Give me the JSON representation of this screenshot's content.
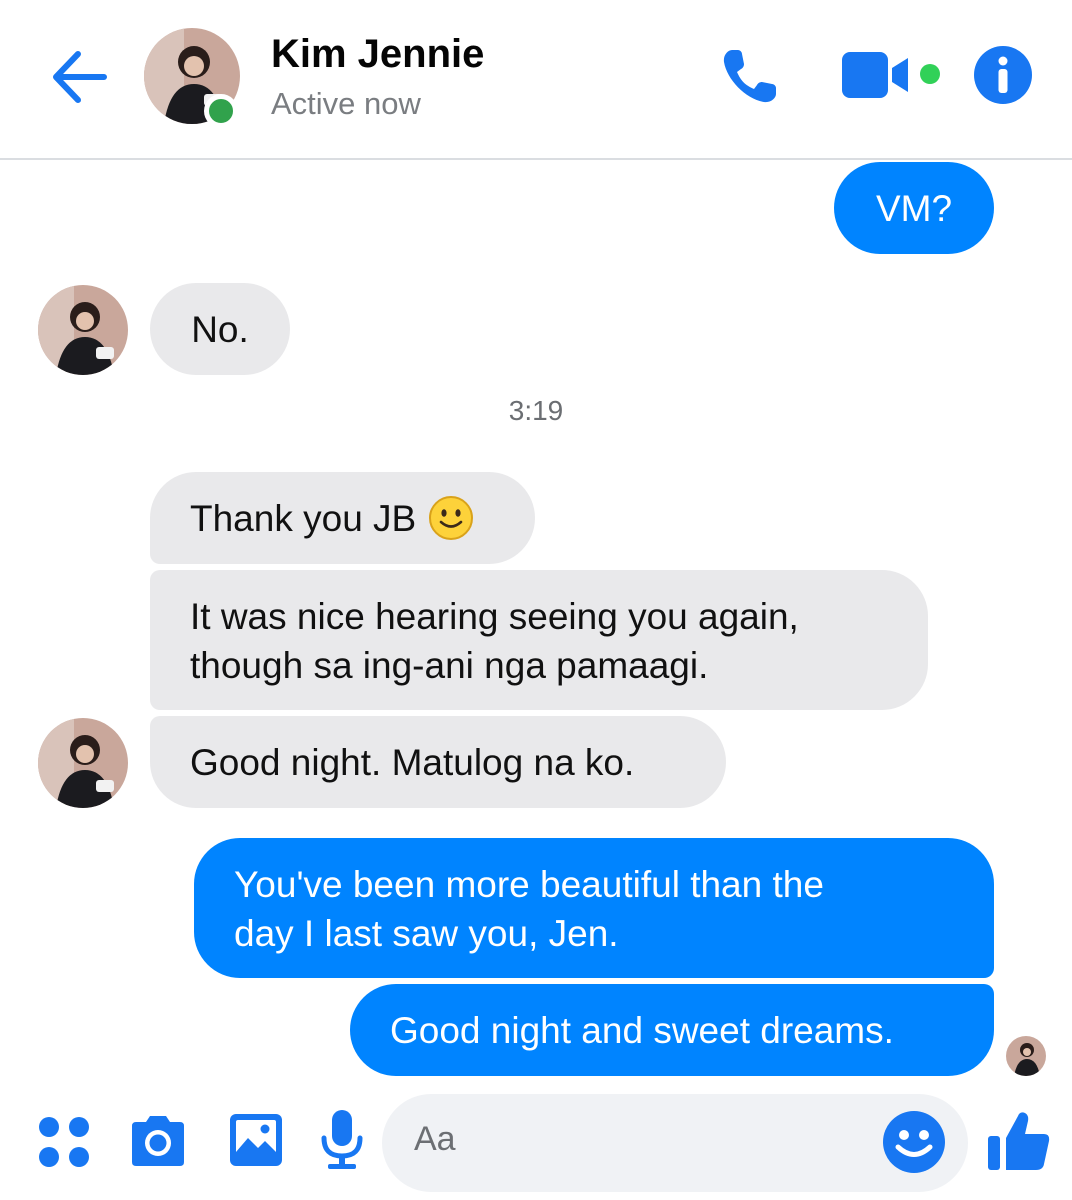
{
  "header": {
    "contact_name": "Kim Jennie",
    "status": "Active now"
  },
  "colors": {
    "messenger_blue": "#0084ff",
    "icon_blue": "#1877f2",
    "incoming_bubble": "#e9e9eb",
    "online_green": "#31a24c"
  },
  "messages": [
    {
      "from": "me",
      "text": "VM?"
    },
    {
      "from": "contact",
      "text": "No."
    },
    {
      "timestamp": "3:19"
    },
    {
      "from": "contact",
      "text": "Thank you JB",
      "emoji": "slightly-smiling-face"
    },
    {
      "from": "contact",
      "line1": "It was nice hearing seeing you again,",
      "line2": "though sa ing-ani nga pamaagi."
    },
    {
      "from": "contact",
      "text": "Good night. Matulog na ko."
    },
    {
      "from": "me",
      "line1": "You've been more beautiful than the",
      "line2": "day I last saw you, Jen."
    },
    {
      "from": "me",
      "text": "Good night and sweet dreams."
    }
  ],
  "composer": {
    "placeholder": "Aa"
  },
  "icons": {
    "back": "arrow-left-icon",
    "call": "phone-icon",
    "video": "video-camera-icon",
    "info": "info-icon",
    "apps": "grid-dots-icon",
    "camera": "camera-icon",
    "gallery": "image-icon",
    "voice": "microphone-icon",
    "emoji": "smiley-icon",
    "like": "thumbs-up-icon"
  }
}
